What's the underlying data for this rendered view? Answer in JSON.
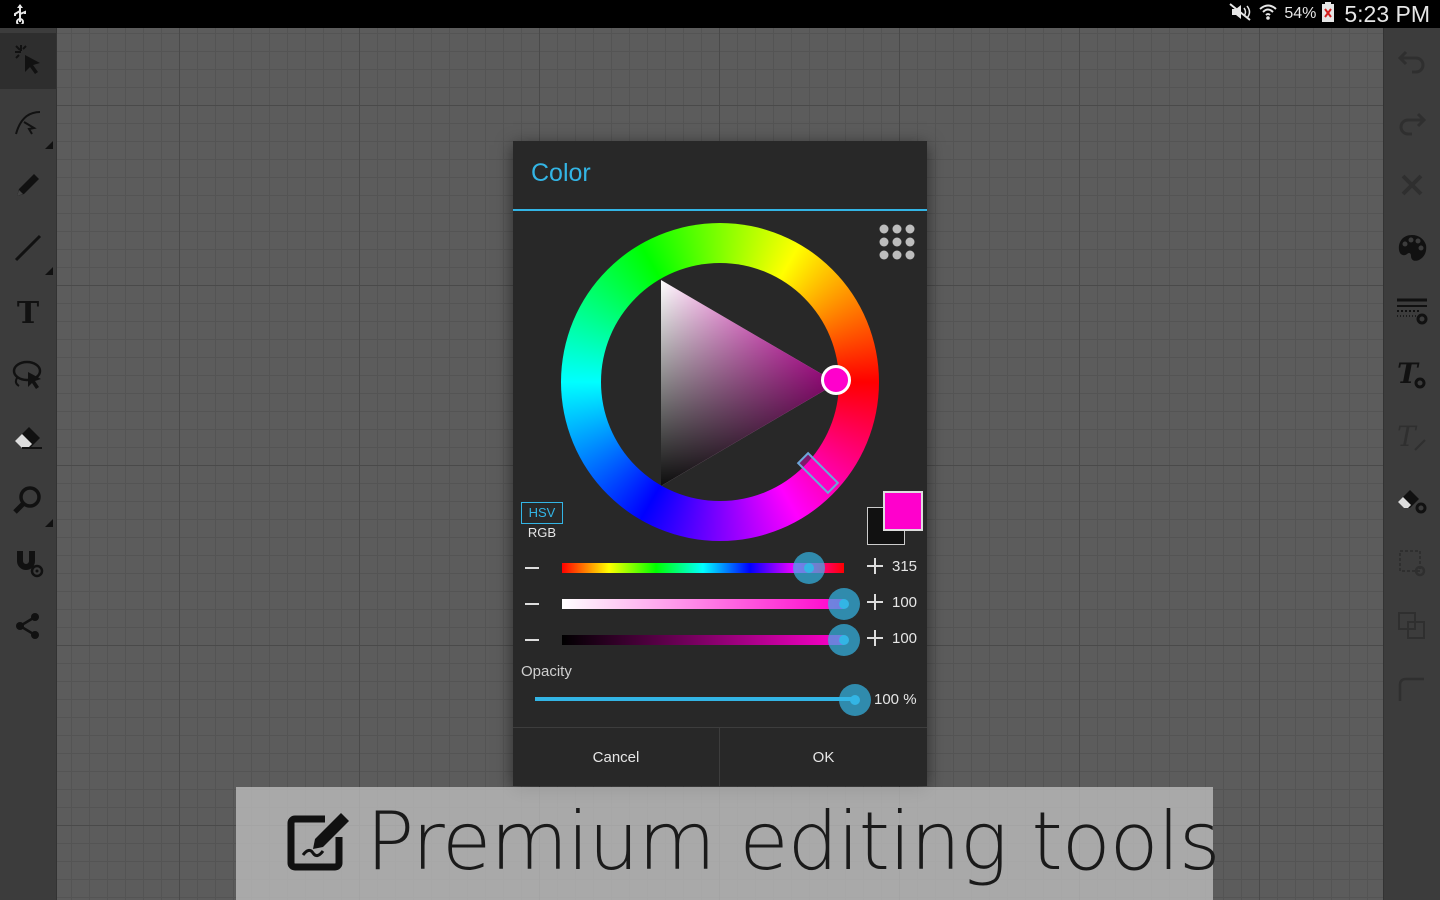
{
  "status_bar": {
    "battery_percent": "54%",
    "time": "5:23 PM",
    "icons": [
      "usb-icon",
      "mute-icon",
      "wifi-icon",
      "battery-icon"
    ]
  },
  "left_toolbar": {
    "tools": [
      {
        "name": "select-tool",
        "icon": "magic-select-icon",
        "active": true
      },
      {
        "name": "curve-tool",
        "icon": "curve-icon"
      },
      {
        "name": "pencil-tool",
        "icon": "pencil-icon"
      },
      {
        "name": "line-tool",
        "icon": "line-icon"
      },
      {
        "name": "text-tool",
        "icon": "text-icon",
        "label": "T"
      },
      {
        "name": "lasso-tool",
        "icon": "lasso-icon"
      },
      {
        "name": "eraser-tool",
        "icon": "eraser-icon"
      },
      {
        "name": "zoom-tool",
        "icon": "search-icon"
      },
      {
        "name": "magnet-tool",
        "icon": "magnet-icon"
      },
      {
        "name": "share-tool",
        "icon": "share-icon"
      }
    ]
  },
  "right_toolbar": {
    "tools": [
      {
        "name": "undo",
        "icon": "undo-icon",
        "enabled": false
      },
      {
        "name": "redo",
        "icon": "redo-icon",
        "enabled": false
      },
      {
        "name": "delete",
        "icon": "close-icon",
        "enabled": false
      },
      {
        "name": "palette",
        "icon": "palette-icon",
        "enabled": true
      },
      {
        "name": "line-settings",
        "icon": "line-settings-icon",
        "enabled": true
      },
      {
        "name": "text-settings",
        "icon": "text-settings-icon",
        "enabled": true,
        "label": "T"
      },
      {
        "name": "text-style",
        "icon": "text-style-icon",
        "enabled": false,
        "label": "T"
      },
      {
        "name": "eraser-settings",
        "icon": "eraser-settings-icon",
        "enabled": true
      },
      {
        "name": "selection-settings",
        "icon": "selection-settings-icon",
        "enabled": false
      },
      {
        "name": "arrange",
        "icon": "arrange-icon",
        "enabled": false
      },
      {
        "name": "corner",
        "icon": "corner-icon",
        "enabled": false
      }
    ]
  },
  "color_dialog": {
    "title": "Color",
    "mode_selected": "HSV",
    "mode_other": "RGB",
    "accent_color": "#33b5e5",
    "current_color": "#ff00cc",
    "previous_color": "#111111",
    "sliders": [
      {
        "name": "hue",
        "value": 315,
        "max": 360,
        "display": "315"
      },
      {
        "name": "saturation",
        "value": 100,
        "max": 100,
        "display": "100"
      },
      {
        "name": "value",
        "value": 100,
        "max": 100,
        "display": "100"
      }
    ],
    "opacity": {
      "label": "Opacity",
      "value": 100,
      "display": "100 %"
    },
    "cancel_label": "Cancel",
    "ok_label": "OK"
  },
  "banner": {
    "text": "Premium editing tools",
    "icon": "edit-icon"
  }
}
